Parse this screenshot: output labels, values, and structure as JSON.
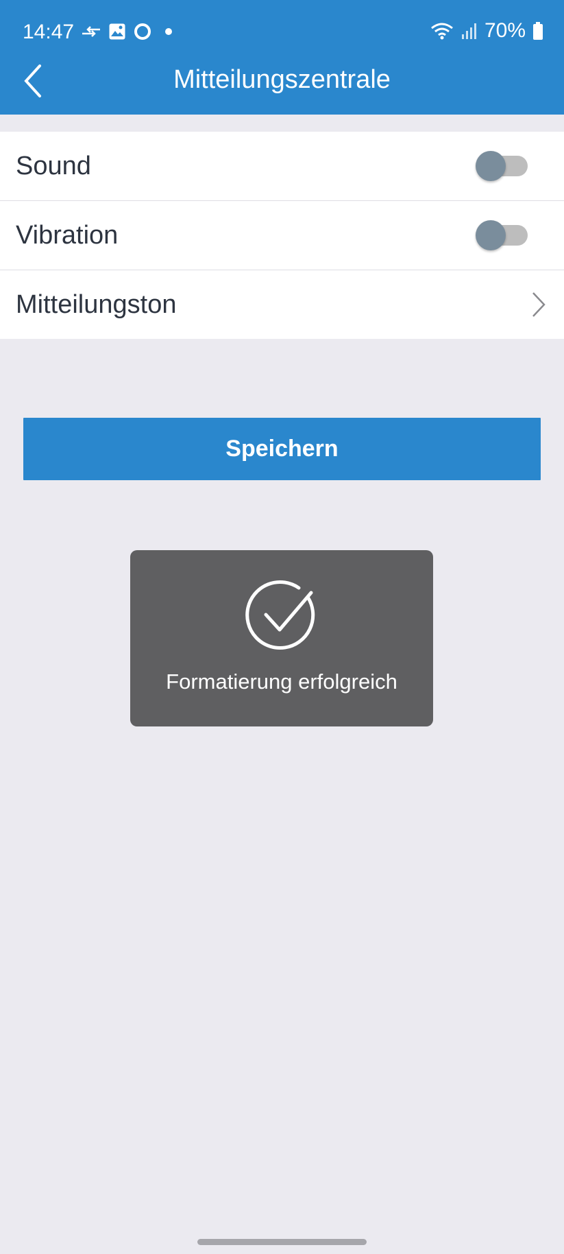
{
  "status_bar": {
    "time": "14:47",
    "battery": "70%"
  },
  "header": {
    "title": "Mitteilungszentrale"
  },
  "settings": {
    "sound_label": "Sound",
    "sound_enabled": false,
    "vibration_label": "Vibration",
    "vibration_enabled": false,
    "tone_label": "Mitteilungston"
  },
  "save_label": "Speichern",
  "toast": {
    "message": "Formatierung erfolgreich"
  },
  "icons": [
    "sync-icon",
    "image-icon",
    "circle-app-icon",
    "notification-dot-icon",
    "wifi-icon",
    "signal-icon",
    "battery-icon",
    "back-arrow-icon",
    "chevron-right-icon",
    "checkmark-circle-icon"
  ],
  "colors": {
    "primary": "#2a87cd",
    "background": "#ebeaf0",
    "toast": "#5f5f61",
    "toggle_thumb_off": "#7a8d9c"
  }
}
